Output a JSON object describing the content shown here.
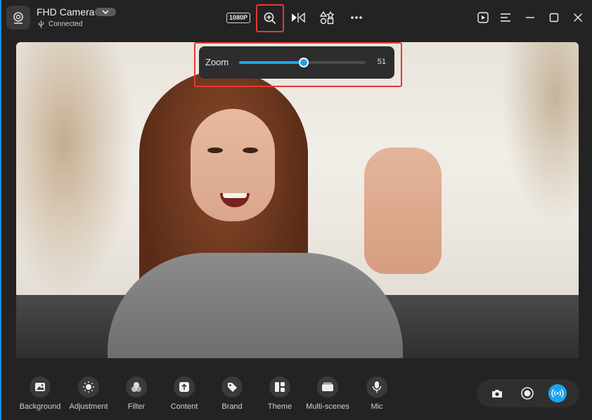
{
  "header": {
    "camera_name": "FHD Camera",
    "status": "Connected",
    "resolution_badge": "1080P"
  },
  "zoom": {
    "label": "Zoom",
    "value": "51",
    "level_percent": 51
  },
  "toolbar": {
    "items": [
      {
        "label": "Background",
        "icon": "image-icon"
      },
      {
        "label": "Adjustment",
        "icon": "sun-icon"
      },
      {
        "label": "Filter",
        "icon": "filter-icon"
      },
      {
        "label": "Content",
        "icon": "upload-icon"
      },
      {
        "label": "Brand",
        "icon": "tag-icon"
      },
      {
        "label": "Theme",
        "icon": "theme-icon"
      },
      {
        "label": "Multi-scenes",
        "icon": "scenes-icon"
      },
      {
        "label": "Mic",
        "icon": "mic-icon"
      }
    ]
  },
  "colors": {
    "accent": "#1aa3f0",
    "highlight": "#e53935",
    "background": "#232323"
  }
}
